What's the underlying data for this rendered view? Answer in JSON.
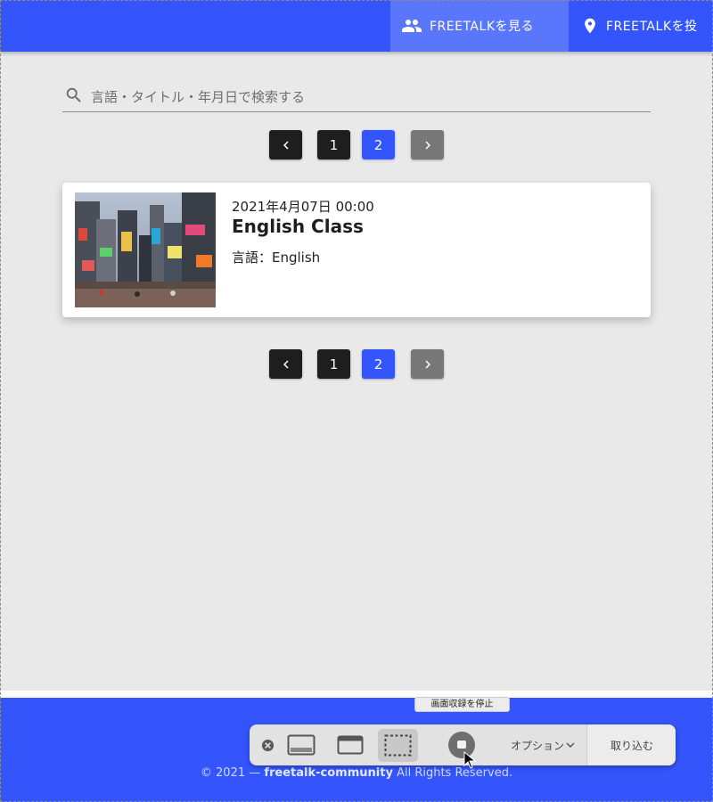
{
  "header": {
    "tabs": [
      {
        "label": "FREETALKを見る",
        "icon": "people-icon",
        "active": true
      },
      {
        "label": "FREETALKを投",
        "icon": "location-pin-icon",
        "active": false
      }
    ]
  },
  "search": {
    "placeholder": "言語・タイトル・年月日で検索する",
    "icon": "search-icon"
  },
  "pagination": {
    "prev_icon": "chevron-left-icon",
    "next_icon": "chevron-right-icon",
    "pages": [
      "1",
      "2"
    ],
    "current_page": "2"
  },
  "posts": [
    {
      "date": "2021年4月07日 00:00",
      "title": "English Class",
      "language": "言語：English",
      "thumbnail": "city-street-photo"
    }
  ],
  "footer": {
    "copyright_prefix": "© 2021 — ",
    "copyright_owner": "freetalk-community",
    "copyright_suffix": " All Rights Reserved."
  },
  "capture_toolbar": {
    "tooltip": "画面収録を停止",
    "options_label": "オプション",
    "capture_label": "取り込む",
    "icons": [
      "close-circle-icon",
      "capture-screen-icon",
      "capture-window-icon",
      "capture-selection-icon",
      "stop-recording-icon"
    ]
  },
  "colors": {
    "brand_blue": "#3355fb",
    "dark_button": "#1e1e1e",
    "disabled_button": "#777777",
    "background": "#e9e9e9"
  }
}
